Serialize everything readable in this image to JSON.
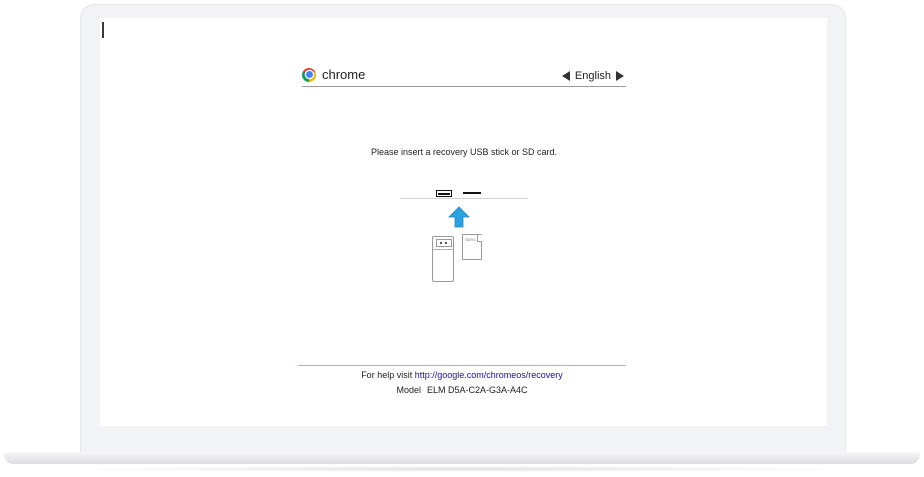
{
  "header": {
    "brand": "chrome",
    "language": "English"
  },
  "prompt": "Please insert a recovery USB stick or SD card.",
  "illustration": {
    "sd_label": "SDHC",
    "arrow_color": "#29a3e0"
  },
  "footer": {
    "help_text": "For help visit",
    "help_link": "http://google.com/chromeos/recovery",
    "model_label": "Model",
    "model_value": "ELM D5A-C2A-G3A-A4C"
  }
}
